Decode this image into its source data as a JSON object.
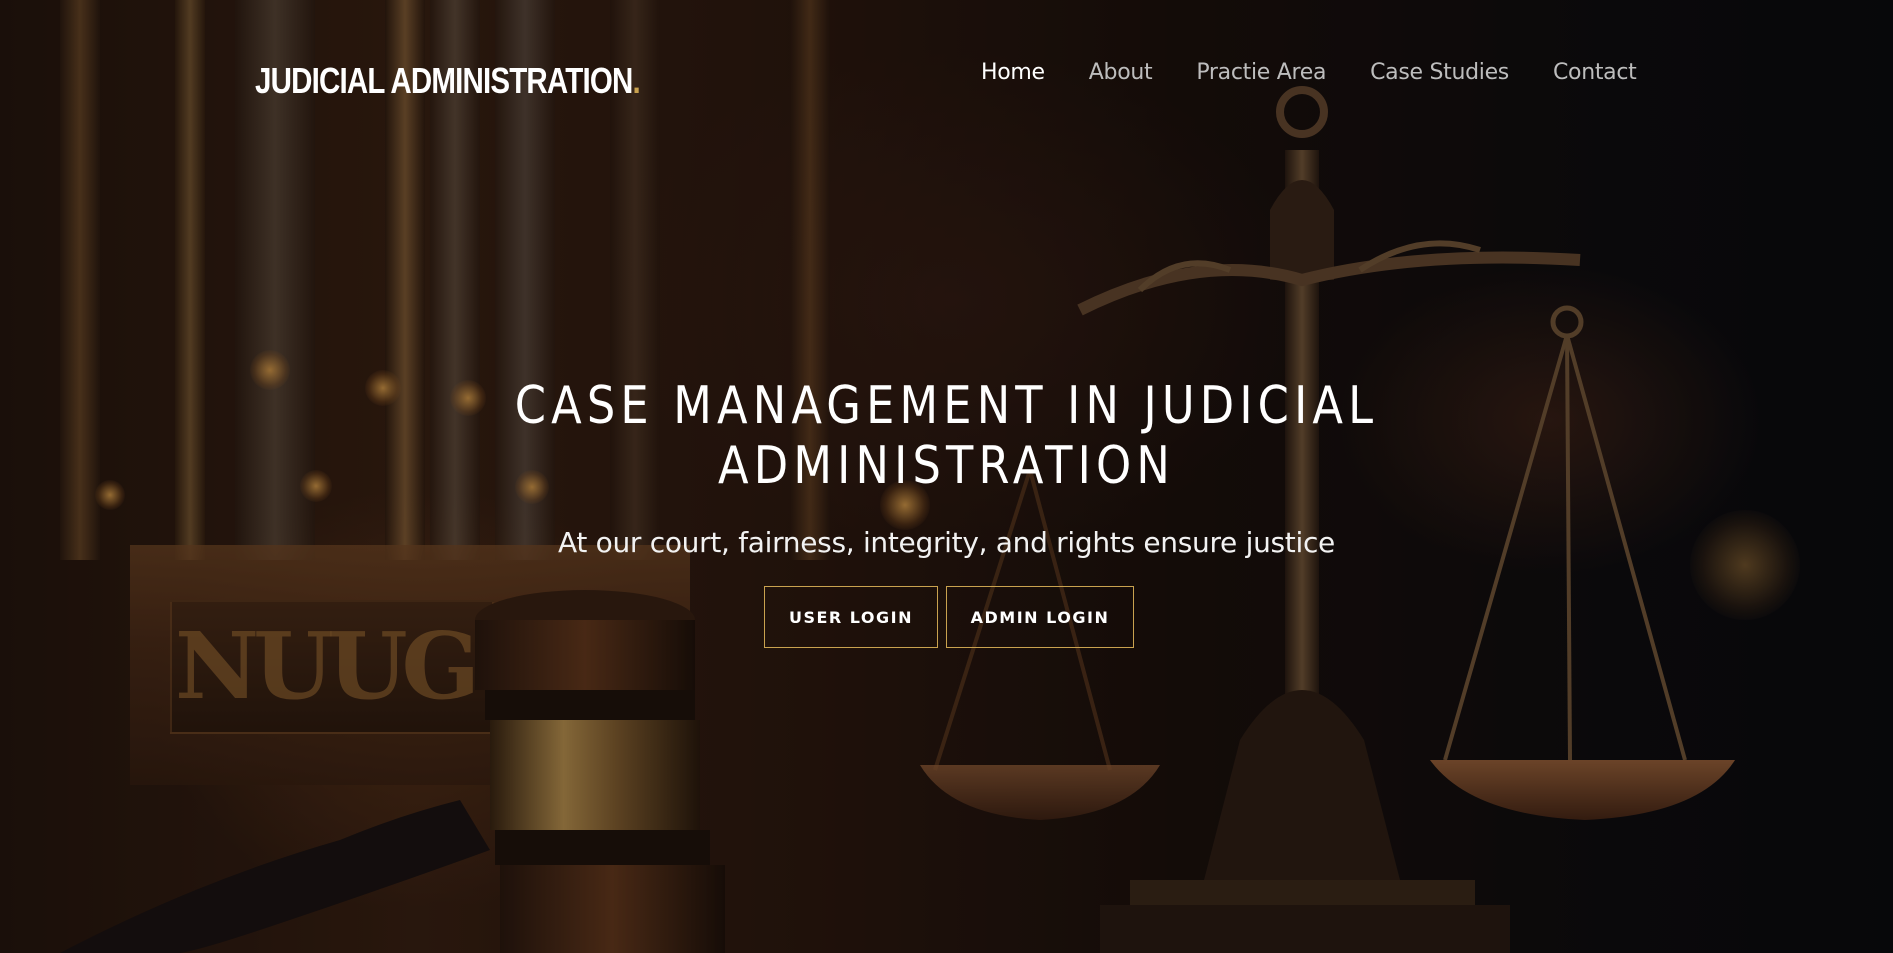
{
  "header": {
    "logo_text": "JUDICIAL ADMINISTRATION",
    "logo_dot": ".",
    "nav": [
      {
        "label": "Home",
        "active": true
      },
      {
        "label": "About",
        "active": false
      },
      {
        "label": "Practie Area",
        "active": false
      },
      {
        "label": "Case Studies",
        "active": false
      },
      {
        "label": "Contact",
        "active": false
      }
    ]
  },
  "hero": {
    "title_line1": "CASE MANAGEMENT IN JUDICIAL",
    "title_line2": "ADMINISTRATION",
    "subtitle": "At our court, fairness, integrity, and rights ensure justice",
    "buttons": {
      "user_login": "USER LOGIN",
      "admin_login": "ADMIN LOGIN"
    },
    "background_image": "courtroom-gavel-and-scales",
    "bench_text": "NUUG"
  },
  "colors": {
    "accent": "#c9a24f",
    "nav_inactive": "#bdbdbd",
    "nav_active": "#ffffff"
  }
}
